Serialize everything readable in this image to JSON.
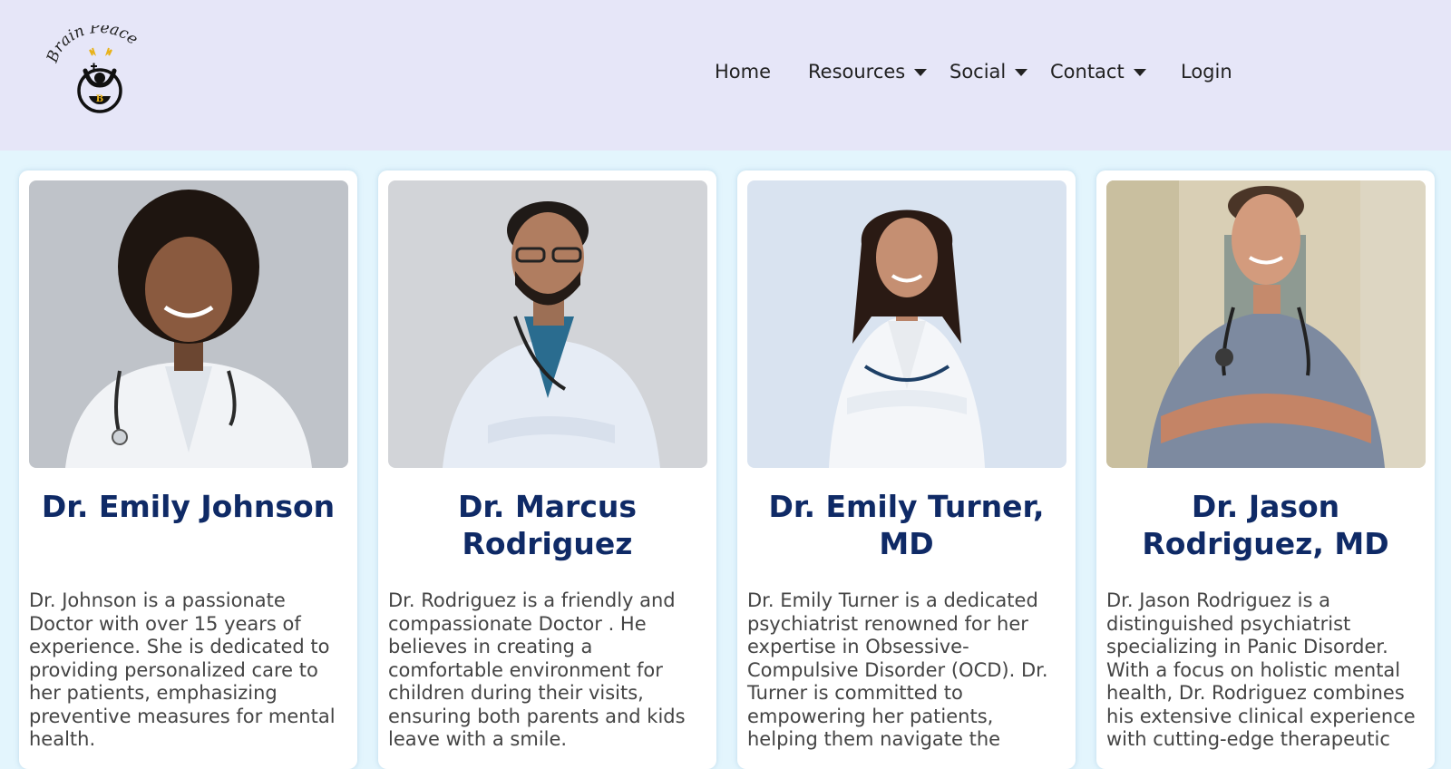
{
  "site": {
    "logo_text": "Brain Peace",
    "logo_letter": "B"
  },
  "nav": {
    "items": [
      {
        "label": "Home",
        "has_dropdown": false
      },
      {
        "label": "Resources",
        "has_dropdown": true
      },
      {
        "label": "Social",
        "has_dropdown": true
      },
      {
        "label": "Contact",
        "has_dropdown": true
      },
      {
        "label": "Login",
        "has_dropdown": false
      }
    ]
  },
  "doctors": [
    {
      "name": "Dr. Emily Johnson",
      "description": "Dr. Johnson is a passionate Doctor with over 15 years of experience. She is dedicated to providing personalized care to her patients, emphasizing preventive measures for mental health."
    },
    {
      "name": "Dr. Marcus Rodriguez",
      "description": "Dr. Rodriguez is a friendly and compassionate Doctor . He believes in creating a comfortable environment for children during their visits, ensuring both parents and kids leave with a smile."
    },
    {
      "name": "Dr. Emily Turner, MD",
      "description": "Dr. Emily Turner is a dedicated psychiatrist renowned for her expertise in Obsessive-Compulsive Disorder (OCD). Dr. Turner is committed to empowering her patients, helping them navigate the"
    },
    {
      "name": "Dr. Jason Rodriguez, MD",
      "description": "Dr. Jason Rodriguez is a distinguished psychiatrist specializing in Panic Disorder. With a focus on holistic mental health, Dr. Rodriguez combines his extensive clinical experience with cutting-edge therapeutic"
    }
  ],
  "colors": {
    "header_bg": "#e6e6f8",
    "page_bg": "#e3f5fd",
    "name_color": "#0f2a66"
  }
}
